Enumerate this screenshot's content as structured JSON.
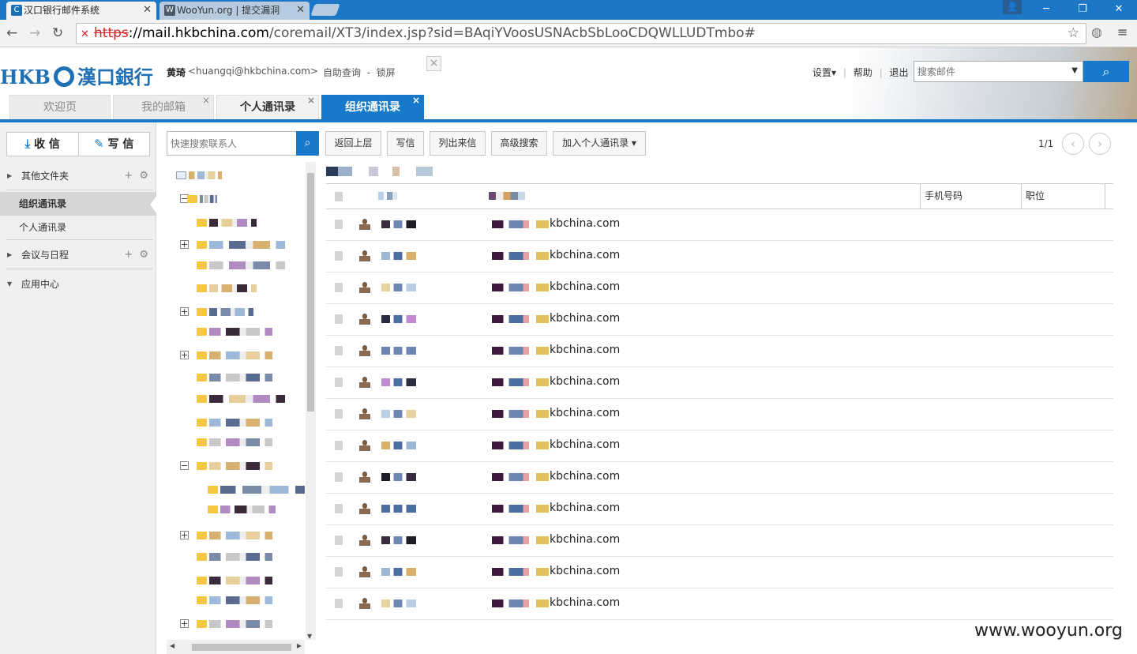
{
  "browser": {
    "tabs": [
      {
        "title": "汉口银行邮件系统",
        "favicon": "C"
      },
      {
        "title": "WooYun.org | 提交漏洞",
        "favicon": "W"
      }
    ],
    "url": {
      "scheme": "https",
      "host": "://mail.hkbchina.com",
      "path": "/coremail/XT3/index.jsp?sid=BAqiYVoosUSNAcbSbLooCDQWLLUDTmbo#"
    }
  },
  "header": {
    "logo_latin": "HKB",
    "logo_cn": "漢口銀行",
    "user_name": "黄琦",
    "user_email": "<huangqi@hkbchina.com>",
    "links": "自助查询  -  锁屏",
    "settings": "设置▾",
    "help": "帮助",
    "logout": "退出",
    "search_placeholder": "搜索邮件"
  },
  "tabs": [
    {
      "label": "欢迎页"
    },
    {
      "label": "我的邮箱"
    },
    {
      "label": "个人通讯录"
    },
    {
      "label": "组织通讯录"
    }
  ],
  "sidebar": {
    "receive": "收 信",
    "compose": "写 信",
    "items": [
      {
        "label": "其他文件夹"
      },
      {
        "label": "组织通讯录"
      },
      {
        "label": "个人通讯录"
      },
      {
        "label": "会议与日程"
      },
      {
        "label": "应用中心"
      }
    ]
  },
  "toolbar": {
    "quick_search_placeholder": "快速搜索联系人",
    "back": "返回上层",
    "compose": "写信",
    "list_mail": "列出来信",
    "advanced": "高级搜索",
    "add_personal": "加入个人通讯录 ▾",
    "pager": "1/1"
  },
  "table": {
    "columns": [
      "手机号码",
      "职位"
    ],
    "email_suffix": "kbchina.com",
    "row_count": 13
  },
  "watermark": "www.wooyun.org",
  "colors": {
    "accent": "#1679c9",
    "brand": "#1f6fb4"
  }
}
